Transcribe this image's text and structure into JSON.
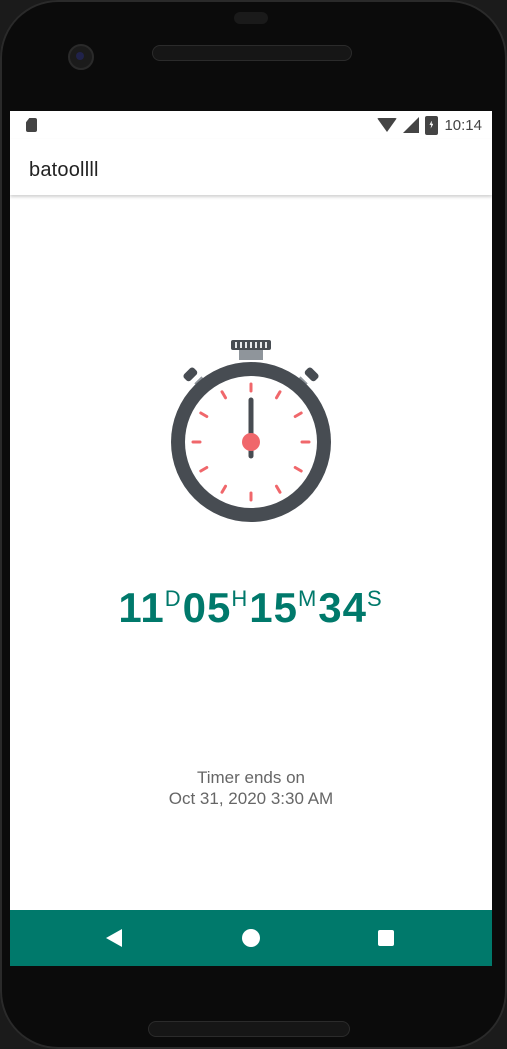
{
  "status_bar": {
    "time": "10:14",
    "icons": [
      "sd-card-icon",
      "wifi-icon",
      "signal-icon",
      "battery-charging-icon"
    ]
  },
  "app_bar": {
    "title": "batoollll"
  },
  "countdown": {
    "days": "11",
    "days_unit": "D",
    "hours": "05",
    "hours_unit": "H",
    "minutes": "15",
    "minutes_unit": "M",
    "seconds": "34",
    "seconds_unit": "S"
  },
  "timer_info": {
    "line1": "Timer ends on",
    "line2": "Oct 31, 2020 3:30 AM"
  },
  "nav_bar": {
    "icons": [
      "back-icon",
      "home-icon",
      "recent-apps-icon"
    ]
  },
  "colors": {
    "accent": "#00796b",
    "stopwatch_body": "#474c52",
    "stopwatch_marks": "#f0676b"
  }
}
